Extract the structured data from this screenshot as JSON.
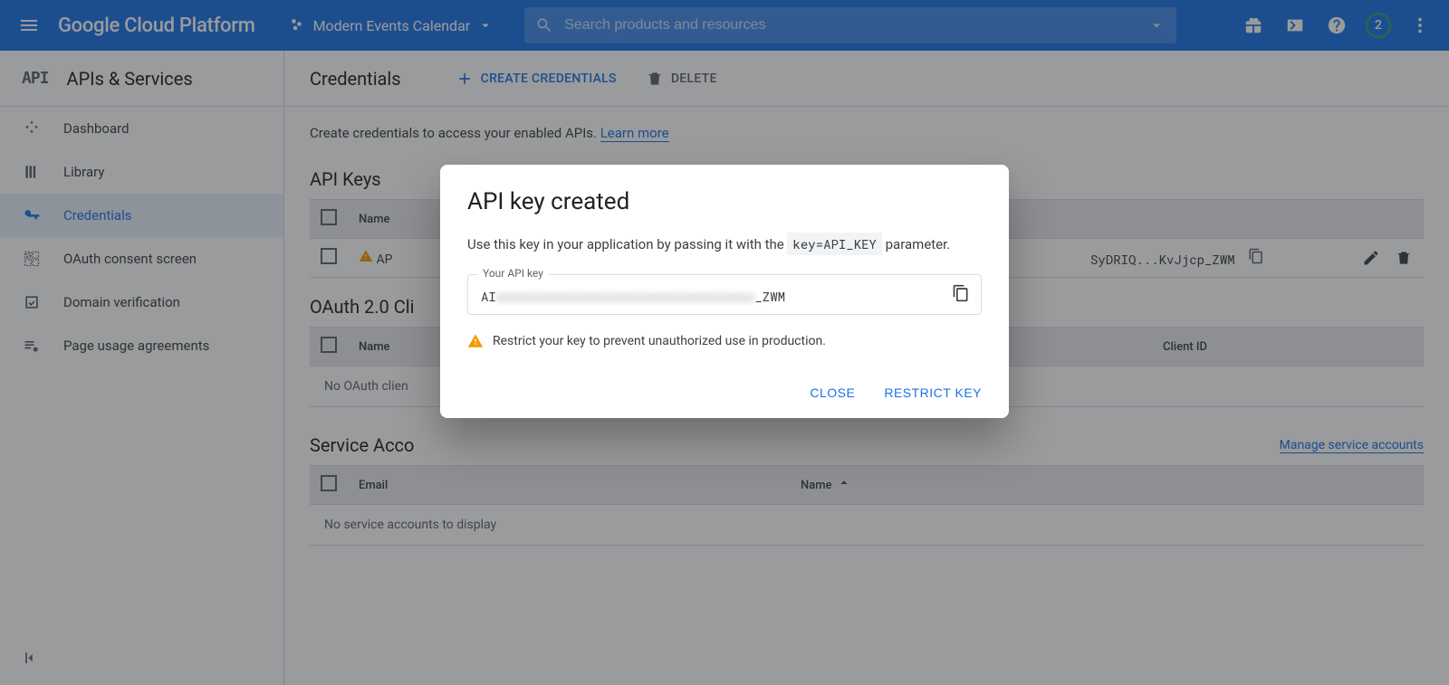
{
  "topbar": {
    "logo": "Google Cloud Platform",
    "project": "Modern Events Calendar",
    "search_placeholder": "Search products and resources",
    "notification_count": "2"
  },
  "sidebar": {
    "title": "APIs & Services",
    "items": [
      {
        "label": "Dashboard"
      },
      {
        "label": "Library"
      },
      {
        "label": "Credentials"
      },
      {
        "label": "OAuth consent screen"
      },
      {
        "label": "Domain verification"
      },
      {
        "label": "Page usage agreements"
      }
    ]
  },
  "page": {
    "title": "Credentials",
    "create_label": "Create Credentials",
    "delete_label": "Delete",
    "hint_text": "Create credentials to access your enabled APIs. ",
    "hint_link": "Learn more"
  },
  "api_keys": {
    "heading": "API Keys",
    "col_name": "Name",
    "row_name": "AP",
    "row_key": "SyDRIQ...KvJjcp_ZWM"
  },
  "oauth": {
    "heading": "OAuth 2.0 Cli",
    "col_name": "Name",
    "col_clientid": "Client ID",
    "empty": "No OAuth clien"
  },
  "service": {
    "heading": "Service Acco",
    "manage_link": "Manage service accounts",
    "col_email": "Email",
    "col_name": "Name",
    "empty": "No service accounts to display"
  },
  "modal": {
    "title": "API key created",
    "desc_pre": "Use this key in your application by passing it with the ",
    "desc_code": "key=API_KEY",
    "desc_post": " parameter.",
    "field_label": "Your API key",
    "key_prefix": "AI",
    "key_suffix": "_ZWM",
    "warning": "Restrict your key to prevent unauthorized use in production.",
    "close": "Close",
    "restrict": "Restrict Key"
  }
}
